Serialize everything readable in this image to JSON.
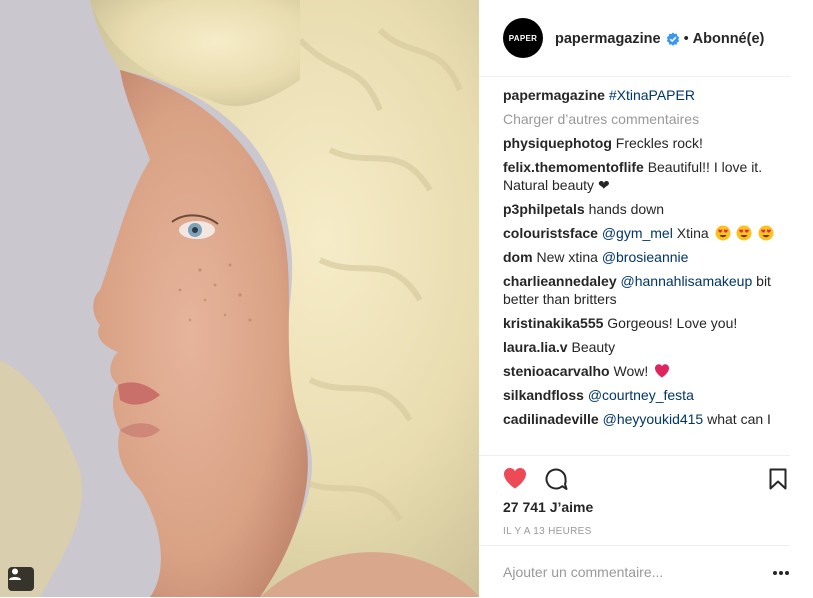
{
  "post": {
    "user_tag_icon": "person-tag-icon"
  },
  "header": {
    "avatar_text": "PAPER",
    "username": "papermagazine",
    "verified_icon": "verified-badge-icon",
    "separator": "•",
    "follow_status": "Abonné(e)"
  },
  "caption": {
    "username": "papermagazine",
    "text": "#XtinaPAPER"
  },
  "load_more": "Charger d’autres commentaires",
  "comments": [
    {
      "user": "physiquephotog",
      "text": "Freckles rock!"
    },
    {
      "user": "felix.themomentoflife",
      "text": "Beautiful!! I love it. Natural beauty ❤"
    },
    {
      "user": "p3philpetals",
      "text": "hands down"
    },
    {
      "user": "colouristsface",
      "mention": "@gym_mel",
      "text": "Xtina",
      "emoji": "heart-eyes-emoji"
    },
    {
      "user": "dom",
      "text": "New xtina",
      "mention": "@brosieannie"
    },
    {
      "user": "charlieannedaley",
      "mention": "@hannahlisamakeup",
      "text": "bit better than britters"
    },
    {
      "user": "kristinakika555",
      "text": "Gorgeous! Love you!"
    },
    {
      "user": "laura.lia.v",
      "text": "Beauty"
    },
    {
      "user": "stenioacarvalho",
      "text": "Wow!",
      "emoji": "red-heart-emoji"
    },
    {
      "user": "silkandfloss",
      "mention": "@courtney_festa"
    },
    {
      "user": "cadilinadeville",
      "mention": "@heyyoukid415",
      "text": "what can I"
    }
  ],
  "actions": {
    "like_icon": "heart-filled-icon",
    "comment_icon": "comment-bubble-icon",
    "save_icon": "bookmark-icon",
    "likes": "27 741 J’aime",
    "timestamp": "IL Y A 13 HEURES"
  },
  "add_comment": {
    "placeholder": "Ajouter un commentaire...",
    "more_icon": "more-options-icon"
  },
  "colors": {
    "text": "#262626",
    "muted": "#999999",
    "link": "#003569",
    "like_red": "#ed4956",
    "verified_blue": "#3897f0"
  }
}
